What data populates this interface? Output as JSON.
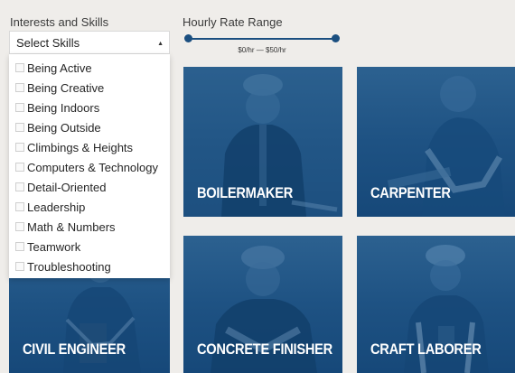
{
  "filters": {
    "skills_label": "Interests and Skills",
    "skills_select_value": "Select Skills",
    "skills_options": [
      "Being Active",
      "Being Creative",
      "Being Indoors",
      "Being Outside",
      "Climbings & Heights",
      "Computers & Technology",
      "Detail-Oriented",
      "Leadership",
      "Math & Numbers",
      "Teamwork",
      "Troubleshooting"
    ],
    "rate_label": "Hourly Rate Range",
    "rate_range_text": "$0/hr — $50/hr",
    "rate_min": 0,
    "rate_max": 50
  },
  "careers": [
    {
      "title": "BOILERMAKER"
    },
    {
      "title": "CARPENTER"
    },
    {
      "title": "CIVIL ENGINEER"
    },
    {
      "title": "CONCRETE FINISHER"
    },
    {
      "title": "CRAFT LABORER"
    }
  ],
  "colors": {
    "page_bg": "#efedea",
    "card_blue": "#1e5283",
    "slider_accent": "#1b4f80"
  }
}
